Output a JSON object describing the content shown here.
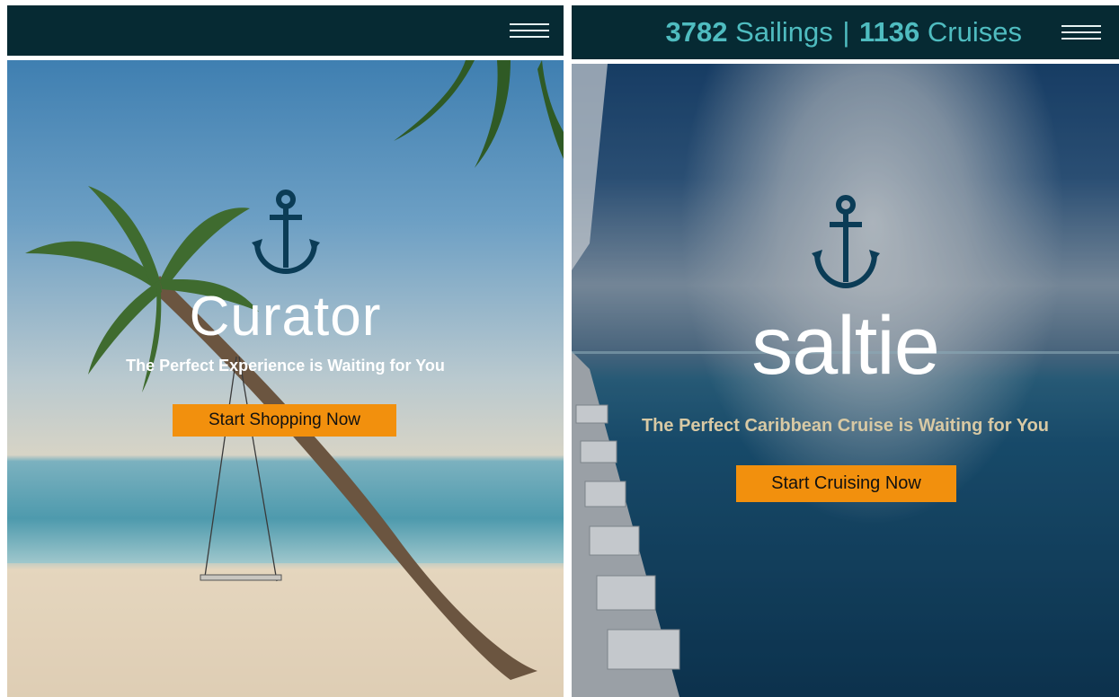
{
  "left": {
    "brand": "Curator",
    "tagline": "The Perfect Experience is Waiting for You",
    "cta_label": "Start Shopping Now"
  },
  "right": {
    "sailings_count": "3782",
    "sailings_label": "Sailings",
    "separator": "|",
    "cruises_count": "1136",
    "cruises_label": "Cruises",
    "brand": "saltie",
    "tagline": "The Perfect Caribbean Cruise is Waiting for You",
    "cta_label": "Start Cruising Now"
  },
  "colors": {
    "header_bg": "#062a33",
    "accent_teal": "#4fbcc0",
    "button_orange": "#f2900d",
    "anchor_blue": "#0b3c56"
  }
}
